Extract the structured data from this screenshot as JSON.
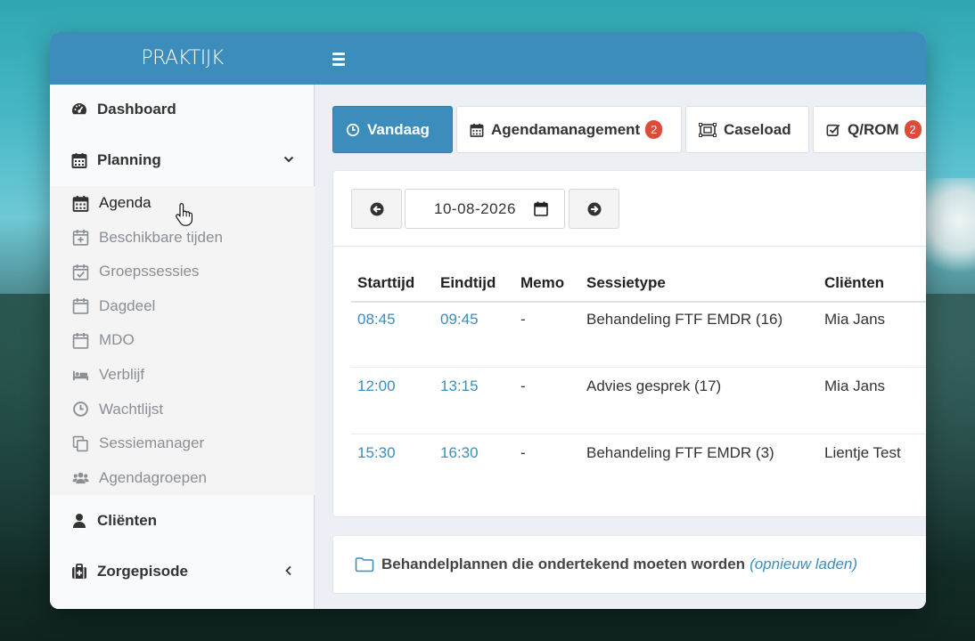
{
  "app": {
    "logo": "PRAKTIJK"
  },
  "sidebar": {
    "dashboard": "Dashboard",
    "planning": "Planning",
    "planning_items": [
      {
        "label": "Agenda",
        "icon": "calendar-icon",
        "active": true
      },
      {
        "label": "Beschikbare tijden",
        "icon": "calendar-plus-icon",
        "active": false
      },
      {
        "label": "Groepssessies",
        "icon": "calendar-check-icon",
        "active": false
      },
      {
        "label": "Dagdeel",
        "icon": "calendar-outline-icon",
        "active": false
      },
      {
        "label": "MDO",
        "icon": "calendar-outline-icon",
        "active": false
      },
      {
        "label": "Verblijf",
        "icon": "bed-icon",
        "active": false
      },
      {
        "label": "Wachtlijst",
        "icon": "clock-icon",
        "active": false
      },
      {
        "label": "Sessiemanager",
        "icon": "copy-icon",
        "active": false
      },
      {
        "label": "Agendagroepen",
        "icon": "users-icon",
        "active": false
      }
    ],
    "clients": "Cliënten",
    "care_episode": "Zorgepisode"
  },
  "tabs": [
    {
      "label": "Vandaag",
      "icon": "clock-icon",
      "badge": null,
      "active": true
    },
    {
      "label": "Agendamanagement",
      "icon": "calendar-icon",
      "badge": "2",
      "active": false
    },
    {
      "label": "Caseload",
      "icon": "caseload-icon",
      "badge": null,
      "active": false
    },
    {
      "label": "Q/ROM",
      "icon": "check-square-icon",
      "badge": "2",
      "active": false
    }
  ],
  "date_picker": {
    "value": "10-08-2026"
  },
  "table": {
    "headers": [
      "Starttijd",
      "Eindtijd",
      "Memo",
      "Sessietype",
      "Cliënten"
    ],
    "rows": [
      {
        "start": "08:45",
        "end": "09:45",
        "memo": "-",
        "type": "Behandeling FTF EMDR (16)",
        "client": "Mia Jans"
      },
      {
        "start": "12:00",
        "end": "13:15",
        "memo": "-",
        "type": "Advies gesprek (17)",
        "client": "Mia Jans"
      },
      {
        "start": "15:30",
        "end": "16:30",
        "memo": "-",
        "type": "Behandeling FTF EMDR (3)",
        "client": "Lientje Test"
      }
    ]
  },
  "plans_panel": {
    "title": "Behandelplannen die ondertekend moeten worden",
    "reload": "(opnieuw laden)"
  },
  "colors": {
    "primary": "#3c8dbc",
    "badge": "#dd4b39",
    "sidebar_bg": "#f9fafc"
  }
}
